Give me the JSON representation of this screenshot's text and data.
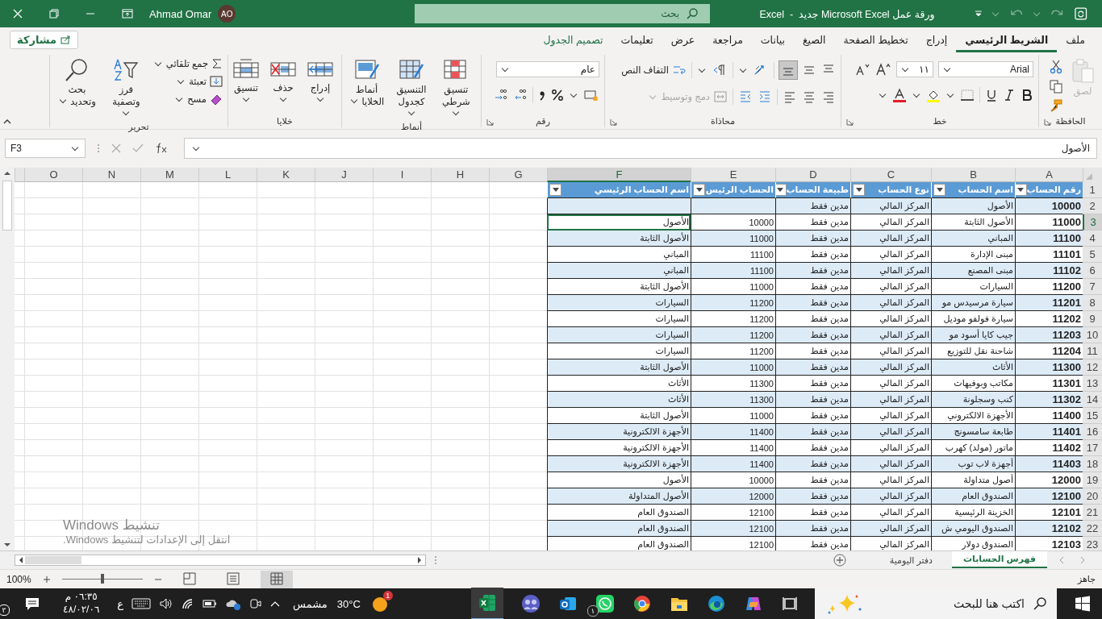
{
  "title_bar": {
    "title": "ورقة عمل Microsoft Excel جديد  -  Excel",
    "search": {
      "placeholder": "بحث"
    },
    "user": {
      "initials": "AO",
      "name": "Ahmad Omar"
    }
  },
  "ribbon_tabs": [
    {
      "label": "ملف",
      "selected": false,
      "contextual": false
    },
    {
      "label": "الشريط الرئيسي",
      "selected": true,
      "contextual": false
    },
    {
      "label": "إدراج",
      "selected": false,
      "contextual": false
    },
    {
      "label": "تخطيط الصفحة",
      "selected": false,
      "contextual": false
    },
    {
      "label": "الصيغ",
      "selected": false,
      "contextual": false
    },
    {
      "label": "بيانات",
      "selected": false,
      "contextual": false
    },
    {
      "label": "مراجعة",
      "selected": false,
      "contextual": false
    },
    {
      "label": "عرض",
      "selected": false,
      "contextual": false
    },
    {
      "label": "تعليمات",
      "selected": false,
      "contextual": false
    },
    {
      "label": "تصميم الجدول",
      "selected": false,
      "contextual": true
    }
  ],
  "share_button": "مشاركة",
  "ribbon_groups": [
    {
      "kind": "clipboard",
      "label": "الحافظة",
      "paste": {
        "label": "لصق",
        "disabled": true
      }
    },
    {
      "kind": "font",
      "label": "خط",
      "font": "Arial",
      "size": "١١"
    },
    {
      "kind": "alignment",
      "label": "محاذاة",
      "bottom_align_selected": true,
      "wrap": "التفاف النص",
      "merge": {
        "label": "دمج وتوسيط",
        "disabled": true
      }
    },
    {
      "kind": "number",
      "label": "رقم",
      "format": "عام"
    },
    {
      "kind": "styles",
      "label": "أنماط",
      "buttons": [
        "تنسيق شرطي",
        "التنسيق كجدول",
        "أنماط الخلايا"
      ]
    },
    {
      "kind": "cells",
      "label": "خلايا",
      "buttons": [
        "إدراج",
        "حذف",
        "تنسيق"
      ]
    },
    {
      "kind": "editing",
      "label": "تحرير",
      "small": [
        "جمع تلقائي",
        "تعبئة",
        "مسح"
      ],
      "buttons": [
        "فرز وتصفية",
        "بحث وتحديد"
      ]
    }
  ],
  "formula_bar": {
    "name_box": "F3",
    "formula": "الأصول"
  },
  "sheet": {
    "columns": [
      {
        "letter": "A",
        "selected": false
      },
      {
        "letter": "B",
        "selected": false
      },
      {
        "letter": "C",
        "selected": false
      },
      {
        "letter": "D",
        "selected": false
      },
      {
        "letter": "E",
        "selected": false
      },
      {
        "letter": "F",
        "selected": true
      },
      {
        "letter": "G",
        "selected": false
      },
      {
        "letter": "H",
        "selected": false
      },
      {
        "letter": "I",
        "selected": false
      },
      {
        "letter": "J",
        "selected": false
      },
      {
        "letter": "K",
        "selected": false
      },
      {
        "letter": "L",
        "selected": false
      },
      {
        "letter": "M",
        "selected": false
      },
      {
        "letter": "N",
        "selected": false
      },
      {
        "letter": "O",
        "selected": false
      }
    ],
    "rows": [
      {
        "number": "1",
        "selected": false,
        "kind": "header",
        "cells": [
          "رقم الحساب",
          "اسم الحساب",
          "نوع الحساب",
          "طبيعة الحساب",
          "الحساب الرئيس",
          "اسم الحساب الرئيسي"
        ]
      },
      {
        "number": "2",
        "selected": false,
        "kind": "data",
        "cells": [
          "10000",
          "الأصول",
          "المركز المالي",
          "مدين فقط",
          "",
          ""
        ]
      },
      {
        "number": "3",
        "selected": true,
        "kind": "data",
        "cells": [
          "11000",
          "الأصول الثابتة",
          "المركز المالي",
          "مدين فقط",
          "10000",
          "الأصول"
        ]
      },
      {
        "number": "4",
        "selected": false,
        "kind": "data",
        "cells": [
          "11100",
          "المباني",
          "المركز المالي",
          "مدين فقط",
          "11000",
          "الأصول الثابتة"
        ]
      },
      {
        "number": "5",
        "selected": false,
        "kind": "data",
        "cells": [
          "11101",
          "مبنى الإدارة",
          "المركز المالي",
          "مدين فقط",
          "11100",
          "المباني"
        ]
      },
      {
        "number": "6",
        "selected": false,
        "kind": "data",
        "cells": [
          "11102",
          "مبنى المصنع",
          "المركز المالي",
          "مدين فقط",
          "11100",
          "المباني"
        ]
      },
      {
        "number": "7",
        "selected": false,
        "kind": "data",
        "cells": [
          "11200",
          "السيارات",
          "المركز المالي",
          "مدين فقط",
          "11000",
          "الأصول الثابتة"
        ]
      },
      {
        "number": "8",
        "selected": false,
        "kind": "data",
        "cells": [
          "11201",
          "سيارة مرسيدس مو",
          "المركز المالي",
          "مدين فقط",
          "11200",
          "السيارات"
        ]
      },
      {
        "number": "9",
        "selected": false,
        "kind": "data",
        "cells": [
          "11202",
          "سيارة فولفو موديل",
          "المركز المالي",
          "مدين فقط",
          "11200",
          "السيارات"
        ]
      },
      {
        "number": "10",
        "selected": false,
        "kind": "data",
        "cells": [
          "11203",
          "جيب كايا أسود مو",
          "المركز المالي",
          "مدين فقط",
          "11200",
          "السيارات"
        ]
      },
      {
        "number": "11",
        "selected": false,
        "kind": "data",
        "cells": [
          "11204",
          "شاحنة نقل للتوزيع",
          "المركز المالي",
          "مدين فقط",
          "11200",
          "السيارات"
        ]
      },
      {
        "number": "12",
        "selected": false,
        "kind": "data",
        "cells": [
          "11300",
          "الأثاث",
          "المركز المالي",
          "مدين فقط",
          "11000",
          "الأصول الثابتة"
        ]
      },
      {
        "number": "13",
        "selected": false,
        "kind": "data",
        "cells": [
          "11301",
          "مكاتب وبوفيهات",
          "المركز المالي",
          "مدين فقط",
          "11300",
          "الأثاث"
        ]
      },
      {
        "number": "14",
        "selected": false,
        "kind": "data",
        "cells": [
          "11302",
          "كنب وسجلونة",
          "المركز المالي",
          "مدين فقط",
          "11300",
          "الأثاث"
        ]
      },
      {
        "number": "15",
        "selected": false,
        "kind": "data",
        "cells": [
          "11400",
          "الأجهزة الالكتروني",
          "المركز المالي",
          "مدين فقط",
          "11000",
          "الأصول الثابتة"
        ]
      },
      {
        "number": "16",
        "selected": false,
        "kind": "data",
        "cells": [
          "11401",
          "طابعة سامسونج",
          "المركز المالي",
          "مدين فقط",
          "11400",
          "الأجهزة الالكترونية"
        ]
      },
      {
        "number": "17",
        "selected": false,
        "kind": "data",
        "cells": [
          "11402",
          "ماتور (مولد) كهرب",
          "المركز المالي",
          "مدين فقط",
          "11400",
          "الأجهزة الالكترونية"
        ]
      },
      {
        "number": "18",
        "selected": false,
        "kind": "data",
        "cells": [
          "11403",
          "أجهزة لاب توب",
          "المركز المالي",
          "مدين فقط",
          "11400",
          "الأجهزة الالكترونية"
        ]
      },
      {
        "number": "19",
        "selected": false,
        "kind": "data",
        "cells": [
          "12000",
          "أصول متداولة",
          "المركز المالي",
          "مدين فقط",
          "10000",
          "الأصول"
        ]
      },
      {
        "number": "20",
        "selected": false,
        "kind": "data",
        "cells": [
          "12100",
          "الصندوق العام",
          "المركز المالي",
          "مدين فقط",
          "12000",
          "الأصول المتداولة"
        ]
      },
      {
        "number": "21",
        "selected": false,
        "kind": "data",
        "cells": [
          "12101",
          "الخزينة الرئيسية",
          "المركز المالي",
          "مدين فقط",
          "12100",
          "الصندوق العام"
        ]
      },
      {
        "number": "22",
        "selected": false,
        "kind": "data",
        "cells": [
          "12102",
          "الصندوق اليومي ش",
          "المركز المالي",
          "مدين فقط",
          "12100",
          "الصندوق العام"
        ]
      },
      {
        "number": "23",
        "selected": false,
        "kind": "data",
        "cells": [
          "12103",
          "الصندوق دولار",
          "المركز المالي",
          "مدين فقط",
          "12100",
          "الصندوق العام"
        ]
      }
    ]
  },
  "activation_notice": {
    "title": "تنشيط Windows",
    "text": "انتقل إلى الإعدادات لتنشيط Windows."
  },
  "sheet_tabs": [
    {
      "label": "فهرس الحسابات",
      "selected": true
    },
    {
      "label": "دفتر اليومية",
      "selected": false
    }
  ],
  "status_bar": {
    "status": "جاهز",
    "zoom": {
      "label": "100%",
      "level": 0.5
    }
  },
  "taskbar": {
    "search": {
      "placeholder": "اكتب هنا للبحث"
    },
    "whatsapp_badge": "١",
    "weather": {
      "temperature": "30°C",
      "condition": "مشمس",
      "badge": "1"
    },
    "language": "ع",
    "time": "٠٦:٣٥ م",
    "date": "٤٨/٠٢/٠٦",
    "notifications": "٣"
  }
}
